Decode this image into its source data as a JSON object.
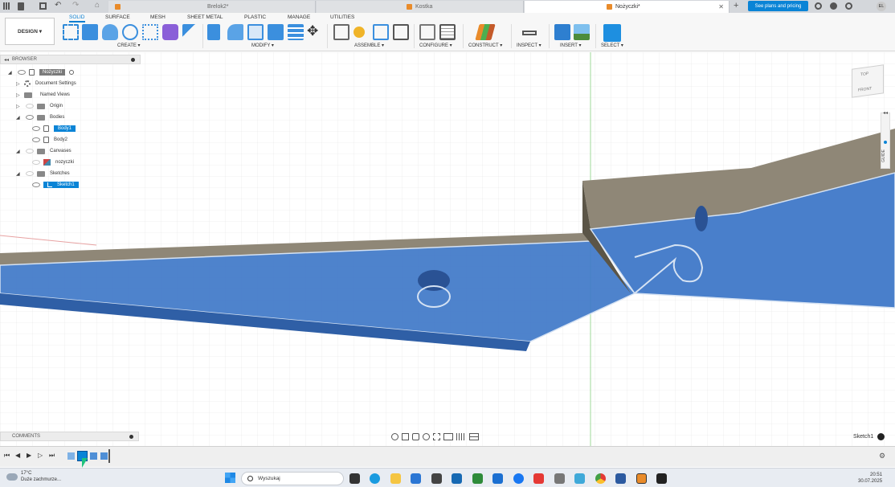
{
  "tabs": [
    {
      "label": "Brelok2*",
      "active": false
    },
    {
      "label": "Kostka",
      "active": false
    },
    {
      "label": "Nożyczki*",
      "active": true
    }
  ],
  "topbar": {
    "plans_label": "See plans and pricing",
    "user_initials": "EL"
  },
  "ribbon": {
    "design_label": "DESIGN ▾",
    "tabs": [
      "SOLID",
      "SURFACE",
      "MESH",
      "SHEET METAL",
      "PLASTIC",
      "MANAGE",
      "UTILITIES"
    ],
    "groups": [
      "CREATE ▾",
      "MODIFY ▾",
      "ASSEMBLE ▾",
      "CONFIGURE ▾",
      "CONSTRUCT ▾",
      "INSPECT ▾",
      "INSERT ▾",
      "SELECT ▾"
    ]
  },
  "browser": {
    "title": "BROWSER",
    "root": "Nożyczki",
    "items": [
      {
        "label": "Document Settings"
      },
      {
        "label": "Named Views"
      },
      {
        "label": "Origin"
      },
      {
        "label": "Bodies"
      },
      {
        "label": "Body1"
      },
      {
        "label": "Body2"
      },
      {
        "label": "Canvases"
      },
      {
        "label": "nozyczki"
      },
      {
        "label": "Sketches"
      },
      {
        "label": "Sketch1"
      }
    ]
  },
  "viewcube": {
    "top": "TOP",
    "front": "FRONT"
  },
  "guide_label": "GUIDE",
  "comments_label": "COMMENTS",
  "status_sketch": "Sketch1",
  "taskbar": {
    "weather_temp": "17°C",
    "weather_desc": "Duże zachmurze...",
    "search_placeholder": "Wyszukaj",
    "time": "20:51",
    "date": "30.07.2025"
  },
  "colors": {
    "accent": "#0a84d6",
    "body_blue": "#3f78c8",
    "body_tan": "#8f8777"
  }
}
